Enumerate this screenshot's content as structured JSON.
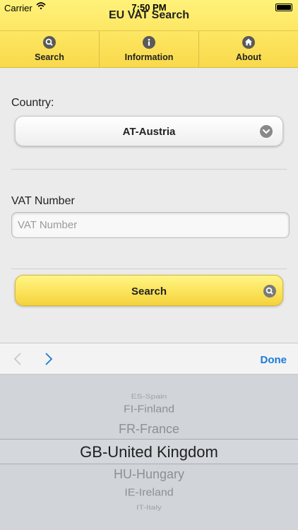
{
  "status_bar": {
    "carrier": "Carrier",
    "time": "7:50 PM"
  },
  "header": {
    "title": "EU VAT Search"
  },
  "tabs": [
    {
      "label": "Search",
      "icon": "search-icon"
    },
    {
      "label": "Information",
      "icon": "info-icon"
    },
    {
      "label": "About",
      "icon": "home-icon"
    }
  ],
  "form": {
    "country_label": "Country:",
    "country_value": "AT-Austria",
    "vat_label": "VAT Number",
    "vat_placeholder": "VAT Number",
    "vat_value": "",
    "search_label": "Search"
  },
  "accessory": {
    "done_label": "Done"
  },
  "picker": {
    "options": [
      "ES-Spain",
      "FI-Finland",
      "FR-France",
      "GB-United Kingdom",
      "HU-Hungary",
      "IE-Ireland",
      "IT-Italy"
    ],
    "selected": "GB-United Kingdom"
  },
  "colors": {
    "header_yellow": "#fde764",
    "accent_blue": "#1a7ad6",
    "picker_bg": "#d1d4d9"
  }
}
